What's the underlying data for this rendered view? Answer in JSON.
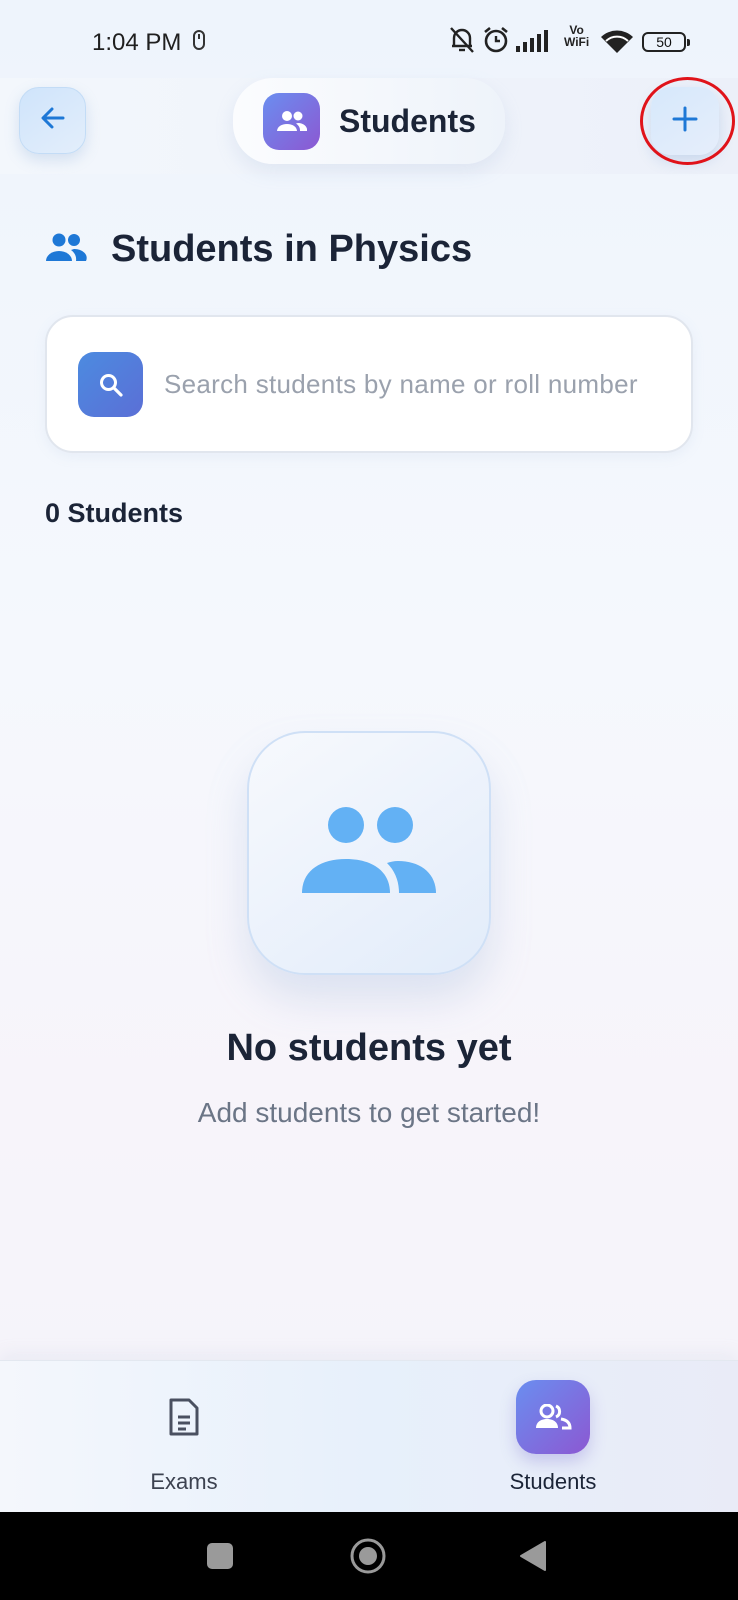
{
  "status_bar": {
    "time": "1:04 PM",
    "vowifi_top": "Vo",
    "vowifi_bottom": "WiFi",
    "battery": "50",
    "icons": [
      "usb-icon",
      "bell-off-icon",
      "alarm-icon",
      "signal-icon",
      "wifi-icon",
      "battery-icon"
    ]
  },
  "header": {
    "title": "Students",
    "back_icon": "arrow-left-icon",
    "add_icon": "plus-icon",
    "title_icon": "people-icon"
  },
  "section": {
    "title": "Students in Physics",
    "icon": "people-icon"
  },
  "search": {
    "placeholder": "Search students by name or roll number",
    "value": "",
    "icon": "search-icon"
  },
  "student_count": "0 Students",
  "empty_state": {
    "icon": "people-icon",
    "title": "No students yet",
    "subtitle": "Add students to get started!"
  },
  "bottom_nav": {
    "items": [
      {
        "label": "Exams",
        "icon": "document-icon",
        "active": false
      },
      {
        "label": "Students",
        "icon": "people-icon",
        "active": true
      }
    ]
  },
  "system_nav": {
    "icons": [
      "recents-square-icon",
      "home-circle-icon",
      "back-triangle-icon"
    ]
  },
  "colors": {
    "accent_blue": "#1e78d6",
    "gradient_start": "#6a8ef0",
    "gradient_end": "#8c58d2",
    "annotation_red": "#e0131a"
  }
}
